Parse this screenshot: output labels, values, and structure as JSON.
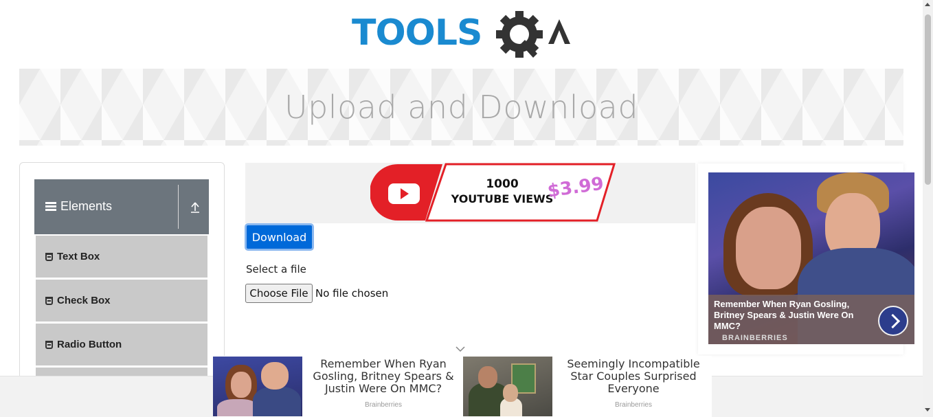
{
  "header": {
    "logo_text_left": "TOOLS",
    "logo_text_right": "QA",
    "page_title": "Upload and Download"
  },
  "sidebar": {
    "group_title": "Elements",
    "items": [
      {
        "label": "Text Box"
      },
      {
        "label": "Check Box"
      },
      {
        "label": "Radio Button"
      }
    ]
  },
  "top_ad": {
    "line1": "1000",
    "line2": "YOUTUBE VIEWS",
    "price": "$3.99"
  },
  "main": {
    "download_label": "Download",
    "select_file_label": "Select a file",
    "choose_file_label": "Choose File",
    "file_status": "No file chosen"
  },
  "right_ad": {
    "headline": "Remember When Ryan Gosling, Britney Spears & Justin Were On MMC?",
    "source": "BRAINBERRIES"
  },
  "bottom_ad": {
    "cards": [
      {
        "headline": "Remember When Ryan Gosling, Britney Spears & Justin Were On MMC?",
        "source": "Brainberries"
      },
      {
        "headline": "Seemingly Incompatible Star Couples Surprised Everyone",
        "source": "Brainberries"
      }
    ]
  },
  "colors": {
    "brand_blue": "#1a8ad0",
    "primary_button": "#0069d9",
    "sidebar_header": "#6c757d",
    "sidebar_item": "#c9c9c9"
  }
}
